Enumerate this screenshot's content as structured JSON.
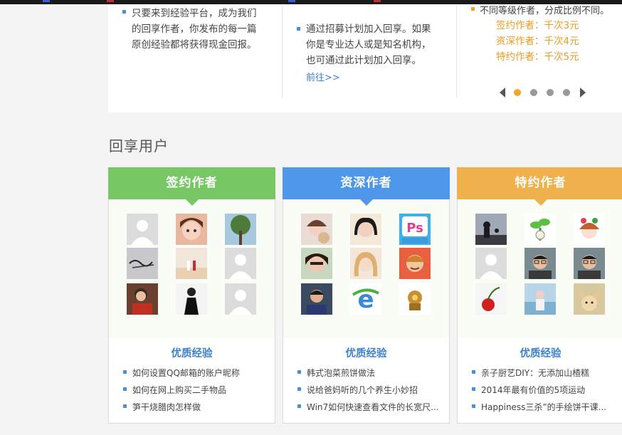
{
  "info": {
    "col1_text": [
      "只要来到经验平台，成为我们",
      "的回享作者，你发布的每一篇",
      "原创经验都将获得现金回报。"
    ],
    "col2_text": [
      "通过招募计划加入回享。如果",
      "你是专业达人或是知名机构，",
      "也可通过此计划加入回享。"
    ],
    "col2_link": "前往>>",
    "col3_top": "不同等级作者，分成比例不同。",
    "rates": [
      "签约作者：千次3元",
      "资深作者：千次4元",
      "特约作者：千次5元"
    ]
  },
  "section_title": "回享用户",
  "cards": [
    {
      "title": "签约作者",
      "color": "#77c864",
      "sub_title": "优质经验",
      "links": [
        "如何设置QQ邮箱的账户昵称",
        "如何在网上购买二手物品",
        "笋干烧腊肉怎样做"
      ],
      "avatars": [
        "default-avatar",
        "girl-face-avatar",
        "tree-photo-avatar",
        "calligraphy-avatar",
        "couple-beach-avatar",
        "default-avatar",
        "man-with-gift-avatar",
        "man-in-suit-avatar",
        "default-avatar"
      ]
    },
    {
      "title": "资深作者",
      "color": "#4e97ea",
      "sub_title": "优质经验",
      "links": [
        "韩式泡菜煎饼做法",
        "说给爸妈听的几个养生小妙招",
        "Win7如何快速查看文件的长宽尺..."
      ],
      "avatars": [
        "girl-with-bear-avatar",
        "girl-portrait-avatar",
        "ps-logo-avatar",
        "girl-finger-avatar",
        "blonde-girl-avatar",
        "woman-smiling-avatar",
        "man-portrait-avatar",
        "ie-logo-avatar",
        "golden-ornament-avatar"
      ]
    },
    {
      "title": "特约作者",
      "color": "#f0b04c",
      "sub_title": "优质经验",
      "links": [
        "亲子厨艺DIY：无添加山楂糕",
        "2014年最有价值的5项运动",
        "Happiness三杀”的手绘饼干课..."
      ],
      "avatars": [
        "silhouette-photo-avatar",
        "cartoon-plant-avatar",
        "cartoon-girl-avatar",
        "default-avatar",
        "man-with-glasses-avatar",
        "man-with-glasses-avatar",
        "cherry-avatar",
        "girl-by-water-avatar",
        "fennec-fox-avatar"
      ]
    }
  ]
}
